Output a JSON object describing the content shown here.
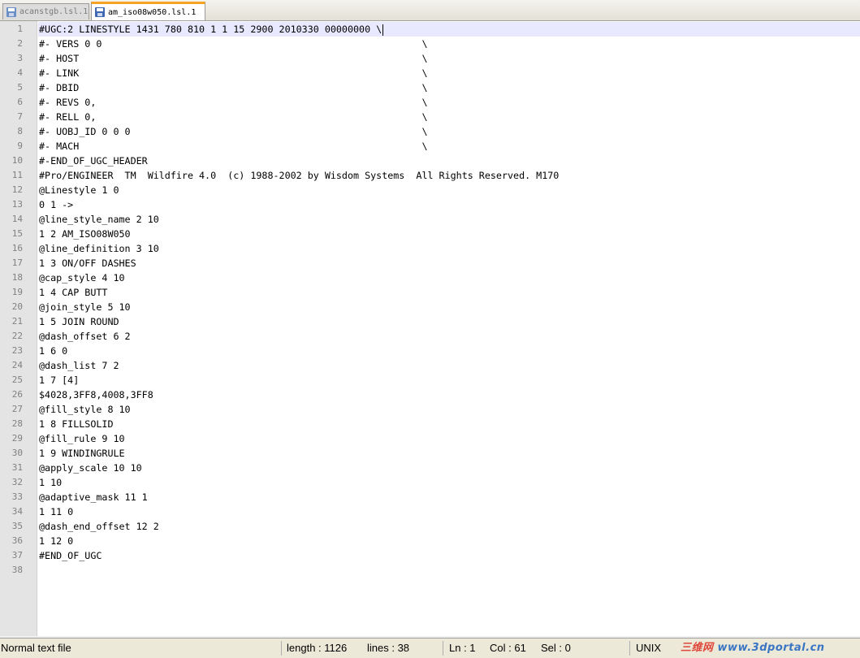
{
  "tabs": [
    {
      "label": "acanstgb.lsl.1",
      "active": false
    },
    {
      "label": "am_iso08w050.lsl.1",
      "active": true
    }
  ],
  "editor": {
    "current_line": 1,
    "lines": [
      "#UGC:2 LINESTYLE 1431 780 810 1 1 15 2900 2010330 00000000 \\",
      "#- VERS 0 0                                                        \\",
      "#- HOST                                                            \\",
      "#- LINK                                                            \\",
      "#- DBID                                                            \\",
      "#- REVS 0,                                                         \\",
      "#- RELL 0,                                                         \\",
      "#- UOBJ_ID 0 0 0                                                   \\",
      "#- MACH                                                            \\",
      "#-END_OF_UGC_HEADER",
      "#Pro/ENGINEER  TM  Wildfire 4.0  (c) 1988-2002 by Wisdom Systems  All Rights Reserved. M170",
      "@Linestyle 1 0",
      "0 1 ->",
      "@line_style_name 2 10",
      "1 2 AM_ISO08W050",
      "@line_definition 3 10",
      "1 3 ON/OFF DASHES",
      "@cap_style 4 10",
      "1 4 CAP BUTT",
      "@join_style 5 10",
      "1 5 JOIN ROUND",
      "@dash_offset 6 2",
      "1 6 0",
      "@dash_list 7 2",
      "1 7 [4]",
      "$4028,3FF8,4008,3FF8",
      "@fill_style 8 10",
      "1 8 FILLSOLID",
      "@fill_rule 9 10",
      "1 9 WINDINGRULE",
      "@apply_scale 10 10",
      "1 10",
      "@adaptive_mask 11 1",
      "1 11 0",
      "@dash_end_offset 12 2",
      "1 12 0",
      "#END_OF_UGC",
      ""
    ]
  },
  "status": {
    "file_type": "Normal text file",
    "length": "length : 1126",
    "lines": "lines : 38",
    "ln": "Ln : 1",
    "col": "Col : 61",
    "sel": "Sel : 0",
    "eol": "UNIX",
    "watermark_cn": "三维网",
    "watermark_url": "www.3dportal.cn"
  },
  "colors": {
    "active_tab_accent": "#f6a323",
    "current_line_highlight": "#e8e8ff",
    "watermark": "#e0453a"
  },
  "icons": [
    "save-floppy-icon"
  ]
}
